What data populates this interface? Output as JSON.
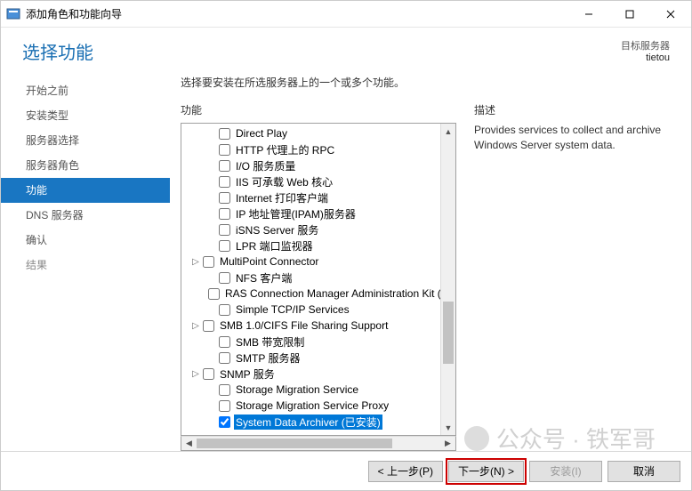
{
  "titlebar": {
    "title": "添加角色和功能向导"
  },
  "header": {
    "heading": "选择功能",
    "targetLabel": "目标服务器",
    "targetServer": "tietou"
  },
  "nav": {
    "items": [
      {
        "label": "开始之前",
        "state": ""
      },
      {
        "label": "安装类型",
        "state": ""
      },
      {
        "label": "服务器选择",
        "state": ""
      },
      {
        "label": "服务器角色",
        "state": ""
      },
      {
        "label": "功能",
        "state": "active"
      },
      {
        "label": "DNS 服务器",
        "state": ""
      },
      {
        "label": "确认",
        "state": ""
      },
      {
        "label": "结果",
        "state": "dim"
      }
    ]
  },
  "main": {
    "instruction": "选择要安装在所选服务器上的一个或多个功能。",
    "featuresHead": "功能",
    "descHead": "描述",
    "descText": "Provides services to collect and archive Windows Server system data.",
    "features": [
      {
        "label": "Direct Play",
        "level": 1,
        "exp": "",
        "checked": false,
        "selected": false
      },
      {
        "label": "HTTP 代理上的 RPC",
        "level": 1,
        "exp": "",
        "checked": false,
        "selected": false
      },
      {
        "label": "I/O 服务质量",
        "level": 1,
        "exp": "",
        "checked": false,
        "selected": false
      },
      {
        "label": "IIS 可承载 Web 核心",
        "level": 1,
        "exp": "",
        "checked": false,
        "selected": false
      },
      {
        "label": "Internet 打印客户端",
        "level": 1,
        "exp": "",
        "checked": false,
        "selected": false
      },
      {
        "label": "IP 地址管理(IPAM)服务器",
        "level": 1,
        "exp": "",
        "checked": false,
        "selected": false
      },
      {
        "label": "iSNS Server 服务",
        "level": 1,
        "exp": "",
        "checked": false,
        "selected": false
      },
      {
        "label": "LPR 端口监视器",
        "level": 1,
        "exp": "",
        "checked": false,
        "selected": false
      },
      {
        "label": "MultiPoint Connector",
        "level": 0,
        "exp": "▷",
        "checked": false,
        "selected": false
      },
      {
        "label": "NFS 客户端",
        "level": 1,
        "exp": "",
        "checked": false,
        "selected": false
      },
      {
        "label": "RAS Connection Manager Administration Kit (CMAK)",
        "level": 1,
        "exp": "",
        "checked": false,
        "selected": false
      },
      {
        "label": "Simple TCP/IP Services",
        "level": 1,
        "exp": "",
        "checked": false,
        "selected": false
      },
      {
        "label": "SMB 1.0/CIFS File Sharing Support",
        "level": 0,
        "exp": "▷",
        "checked": false,
        "selected": false
      },
      {
        "label": "SMB 带宽限制",
        "level": 1,
        "exp": "",
        "checked": false,
        "selected": false
      },
      {
        "label": "SMTP 服务器",
        "level": 1,
        "exp": "",
        "checked": false,
        "selected": false
      },
      {
        "label": "SNMP 服务",
        "level": 0,
        "exp": "▷",
        "checked": false,
        "selected": false
      },
      {
        "label": "Storage Migration Service",
        "level": 1,
        "exp": "",
        "checked": false,
        "selected": false
      },
      {
        "label": "Storage Migration Service Proxy",
        "level": 1,
        "exp": "",
        "checked": false,
        "selected": false
      },
      {
        "label": "System Data Archiver (已安装)",
        "level": 1,
        "exp": "",
        "checked": true,
        "selected": true
      }
    ]
  },
  "footer": {
    "prev": "< 上一步(P)",
    "next": "下一步(N) >",
    "install": "安装(I)",
    "cancel": "取消"
  },
  "watermark": "公众号 · 铁军哥"
}
